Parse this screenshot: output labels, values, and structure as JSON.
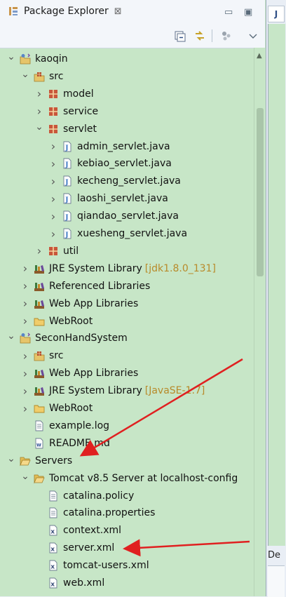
{
  "view": {
    "title": "Package Explorer",
    "close_glyph": "⊠",
    "minimize_glyph": "▭",
    "maximize_glyph": "▣"
  },
  "toolbar": {
    "icons": [
      "collapse-all-icon",
      "link-with-editor-icon",
      "focus-icon",
      "view-menu-icon"
    ]
  },
  "tree": [
    {
      "label": "kaoqin",
      "icon": "project",
      "expanded": true
    },
    {
      "label": "src",
      "icon": "source-folder",
      "expanded": true
    },
    {
      "label": "model",
      "icon": "package",
      "expanded": false
    },
    {
      "label": "service",
      "icon": "package",
      "expanded": false
    },
    {
      "label": "servlet",
      "icon": "package",
      "expanded": true
    },
    {
      "label": "admin_servlet.java",
      "icon": "java-file",
      "expanded": false
    },
    {
      "label": "kebiao_servlet.java",
      "icon": "java-file",
      "expanded": false
    },
    {
      "label": "kecheng_servlet.java",
      "icon": "java-file",
      "expanded": false
    },
    {
      "label": "laoshi_servlet.java",
      "icon": "java-file",
      "expanded": false
    },
    {
      "label": "qiandao_servlet.java",
      "icon": "java-file",
      "expanded": false
    },
    {
      "label": "xuesheng_servlet.java",
      "icon": "java-file",
      "expanded": false
    },
    {
      "label": "util",
      "icon": "package",
      "expanded": false
    },
    {
      "label": "JRE System Library",
      "decoration": "[jdk1.8.0_131]",
      "icon": "library",
      "expanded": false
    },
    {
      "label": "Referenced Libraries",
      "icon": "library",
      "expanded": false
    },
    {
      "label": "Web App Libraries",
      "icon": "library",
      "expanded": false
    },
    {
      "label": "WebRoot",
      "icon": "folder",
      "expanded": false
    },
    {
      "label": "SeconHandSystem",
      "icon": "project",
      "expanded": true
    },
    {
      "label": "src",
      "icon": "source-folder",
      "expanded": false
    },
    {
      "label": "Web App Libraries",
      "icon": "library",
      "expanded": false
    },
    {
      "label": "JRE System Library",
      "decoration": "[JavaSE-1.7]",
      "icon": "library",
      "expanded": false
    },
    {
      "label": "WebRoot",
      "icon": "folder",
      "expanded": false
    },
    {
      "label": "example.log",
      "icon": "text-file"
    },
    {
      "label": "README.md",
      "icon": "markdown-file"
    },
    {
      "label": "Servers",
      "icon": "folder-open",
      "expanded": true
    },
    {
      "label": "Tomcat v8.5 Server at localhost-config",
      "icon": "folder-open",
      "expanded": true
    },
    {
      "label": "catalina.policy",
      "icon": "text-file"
    },
    {
      "label": "catalina.properties",
      "icon": "text-file"
    },
    {
      "label": "context.xml",
      "icon": "xml-file"
    },
    {
      "label": "server.xml",
      "icon": "xml-file",
      "selected": true
    },
    {
      "label": "tomcat-users.xml",
      "icon": "xml-file"
    },
    {
      "label": "web.xml",
      "icon": "xml-file"
    }
  ],
  "editor": {
    "tab_glyph": "J",
    "bottom_tab_label": "De"
  },
  "annotations": {
    "arrow_color": "#e02020"
  },
  "colors": {
    "tree_bg": "#c7e6c7",
    "decoration": "#b88a2a"
  }
}
